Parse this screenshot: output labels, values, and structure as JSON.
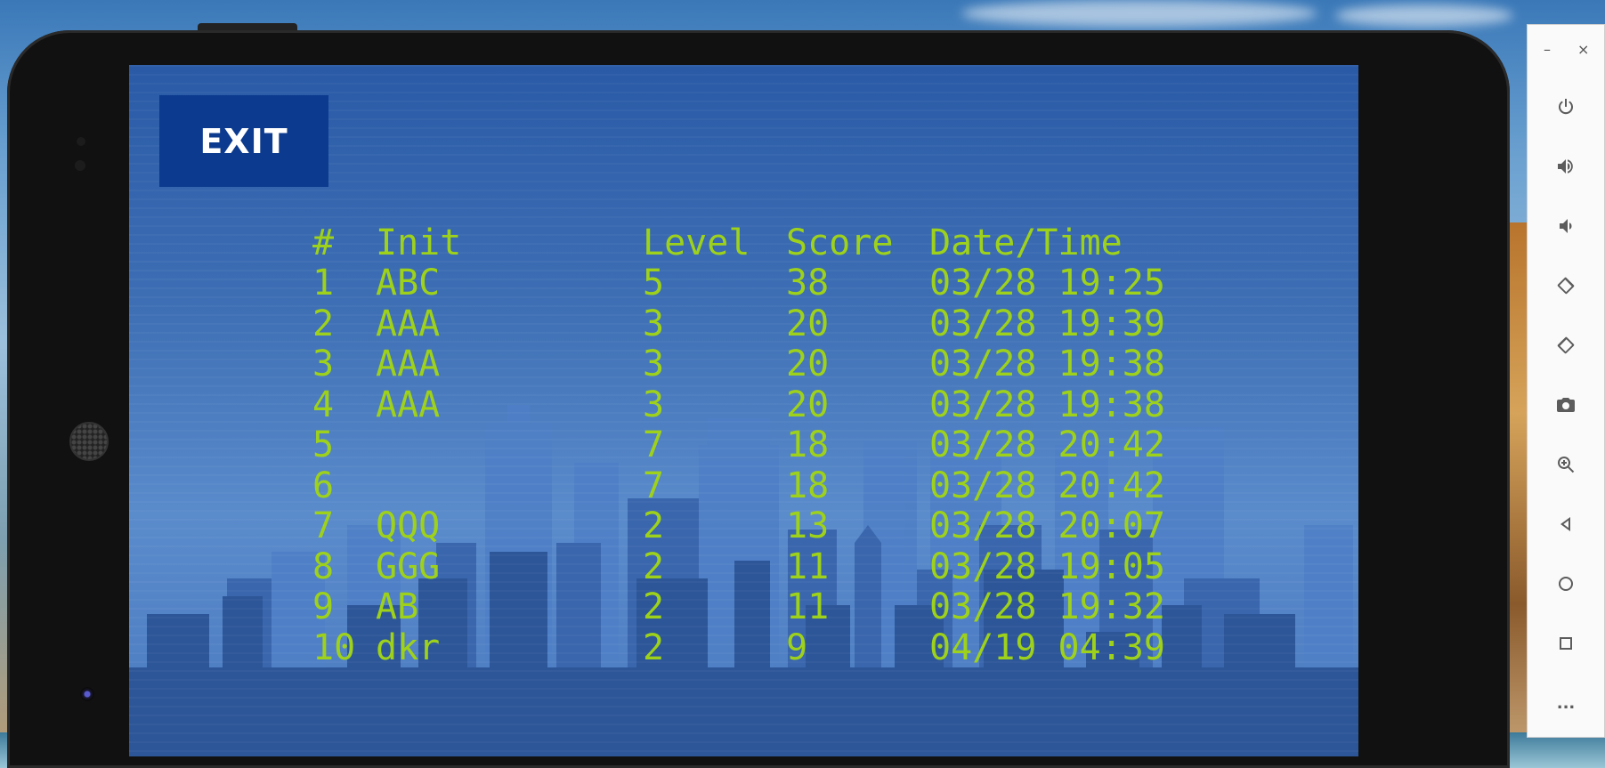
{
  "window": {
    "minimize_label": "–",
    "close_label": "×"
  },
  "app": {
    "exit_label": "EXIT"
  },
  "leaderboard": {
    "headers": [
      "#",
      "Init",
      "Level",
      "Score",
      "Date/Time"
    ],
    "rows": [
      [
        "1",
        "ABC",
        "5",
        "38",
        "03/28 19:25"
      ],
      [
        "2",
        "AAA",
        "3",
        "20",
        "03/28 19:39"
      ],
      [
        "3",
        "AAA",
        "3",
        "20",
        "03/28 19:38"
      ],
      [
        "4",
        "AAA",
        "3",
        "20",
        "03/28 19:38"
      ],
      [
        "5",
        "",
        "7",
        "18",
        "03/28 20:42"
      ],
      [
        "6",
        "",
        "7",
        "18",
        "03/28 20:42"
      ],
      [
        "7",
        "QQQ",
        "2",
        "13",
        "03/28 20:07"
      ],
      [
        "8",
        "GGG",
        "2",
        "11",
        "03/28 19:05"
      ],
      [
        "9",
        "AB",
        "2",
        "11",
        "03/28 19:32"
      ],
      [
        "10",
        "dkr",
        "2",
        "9",
        "04/19 04:39"
      ]
    ]
  },
  "toolbar": {
    "tools": [
      "power-icon",
      "volume-up-icon",
      "volume-down-icon",
      "rotate-left-icon",
      "rotate-right-icon",
      "camera-icon",
      "zoom-icon",
      "back-icon",
      "home-icon",
      "overview-icon",
      "more-icon"
    ],
    "more_label": "..."
  },
  "colors": {
    "score_text": "#9ed21a",
    "exit_bg": "#0b3a8e",
    "screen_top": "#2a5aa6"
  }
}
